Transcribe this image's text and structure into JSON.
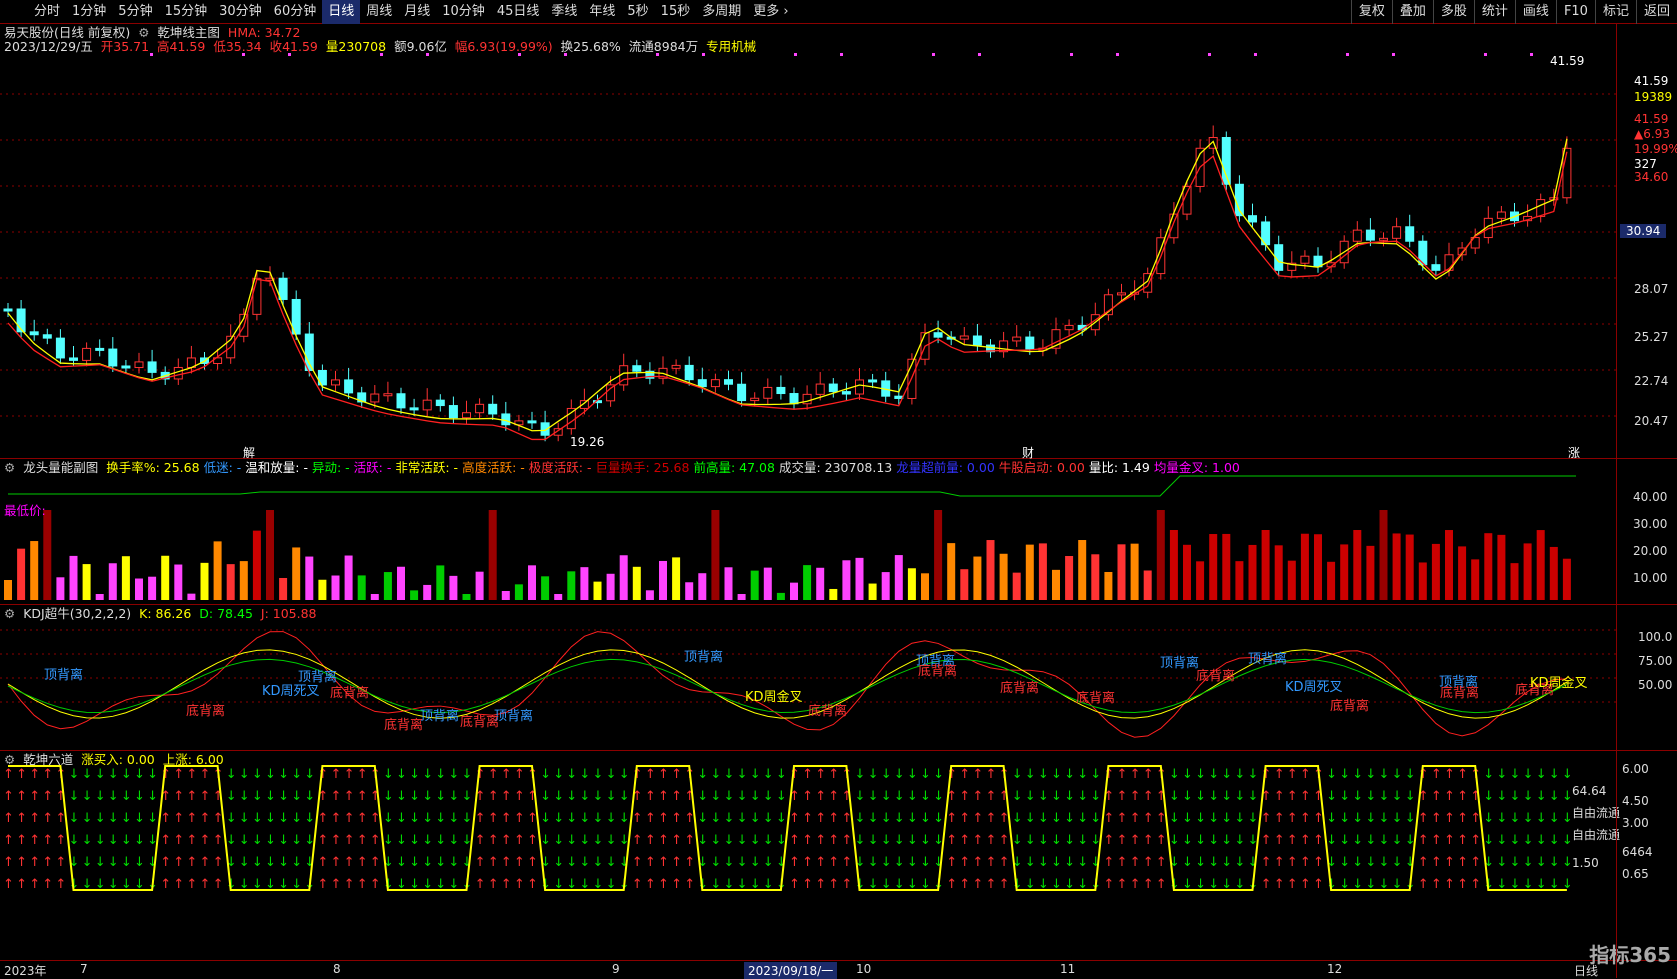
{
  "toolbar": {
    "periods": [
      "分时",
      "1分钟",
      "5分钟",
      "15分钟",
      "30分钟",
      "60分钟",
      "日线",
      "周线",
      "月线",
      "10分钟",
      "45日线",
      "季线",
      "年线",
      "5秒",
      "15秒",
      "多周期",
      "更多"
    ],
    "active": "日线",
    "right": [
      "复权",
      "叠加",
      "多股",
      "统计",
      "画线",
      "F10",
      "标记",
      "返回"
    ]
  },
  "stock": {
    "name": "易天股份(日线 前复权)",
    "indicator": "乾坤线主图",
    "hma": "HMA: 34.72",
    "date": "2023/12/29/五",
    "open": "开35.71",
    "high": "高41.59",
    "low": "低35.34",
    "close": "收41.59",
    "vol": "量230708",
    "amount": "额9.06亿",
    "range": "幅6.93(19.99%)",
    "turnover": "换25.68%",
    "float": "流通8984万",
    "tag": "专用机械"
  },
  "price_axis": {
    "labels": [
      "41.59",
      "19389",
      "41.59",
      "▲6.93",
      "19.99%",
      "327",
      "34.60",
      "30.94",
      "28.07",
      "25.27",
      "22.74",
      "20.47"
    ],
    "high_marker": "41.59",
    "low_marker": "19.26"
  },
  "markers": {
    "m1": "解",
    "m2": "财",
    "m3": "涨"
  },
  "vol_panel": {
    "title": "龙头量能副图",
    "items": [
      {
        "t": "换手率%: 25.68",
        "c": "#ffff00"
      },
      {
        "t": "低迷: -",
        "c": "#3399ff"
      },
      {
        "t": "温和放量: -",
        "c": "#ffffff"
      },
      {
        "t": "异动: -",
        "c": "#00ff00"
      },
      {
        "t": "活跃: -",
        "c": "#ff00ff"
      },
      {
        "t": "非常活跃: -",
        "c": "#ffff00"
      },
      {
        "t": "高度活跃: -",
        "c": "#ff8800"
      },
      {
        "t": "极度活跃: -",
        "c": "#ff3333"
      },
      {
        "t": "巨量换手: 25.68",
        "c": "#cc0000"
      },
      {
        "t": "前高量: 47.08",
        "c": "#00ff00"
      },
      {
        "t": "成交量: 230708.13",
        "c": "#dddddd"
      },
      {
        "t": "龙量超前量: 0.00",
        "c": "#3333ff"
      },
      {
        "t": "牛股启动: 0.00",
        "c": "#ff3333"
      },
      {
        "t": "量比: 1.49",
        "c": "#ffffff"
      },
      {
        "t": "均量金叉: 1.00",
        "c": "#ff00ff"
      }
    ],
    "sub": "最低价:",
    "axis": [
      "40.00",
      "30.00",
      "20.00",
      "10.00"
    ]
  },
  "kdj_panel": {
    "title": "KDJ超牛(30,2,2,2)",
    "k": "K: 86.26",
    "d": "D: 78.45",
    "j": "J: 105.88",
    "axis": [
      "100.0",
      "75.00",
      "50.00"
    ],
    "labels": [
      {
        "t": "顶背离",
        "c": "#3399ff"
      },
      {
        "t": "顶背离",
        "c": "#3399ff"
      },
      {
        "t": "KD周死叉",
        "c": "#3399ff"
      },
      {
        "t": "底背离",
        "c": "#ff3333"
      },
      {
        "t": "底背离",
        "c": "#ff3333"
      },
      {
        "t": "顶背离",
        "c": "#3399ff"
      },
      {
        "t": "底背离",
        "c": "#ff3333"
      },
      {
        "t": "顶背离",
        "c": "#3399ff"
      },
      {
        "t": "底背离",
        "c": "#ff3333"
      },
      {
        "t": "顶背离",
        "c": "#3399ff"
      },
      {
        "t": "KD周金叉",
        "c": "#ffff00"
      },
      {
        "t": "底背离",
        "c": "#ff3333"
      },
      {
        "t": "顶背离",
        "c": "#3399ff"
      },
      {
        "t": "底背离",
        "c": "#ff3333"
      },
      {
        "t": "底背离",
        "c": "#ff3333"
      },
      {
        "t": "底背离",
        "c": "#ff3333"
      },
      {
        "t": "顶背离",
        "c": "#3399ff"
      },
      {
        "t": "底背离",
        "c": "#ff3333"
      },
      {
        "t": "顶背离",
        "c": "#3399ff"
      },
      {
        "t": "KD周死叉",
        "c": "#3399ff"
      },
      {
        "t": "底背离",
        "c": "#ff3333"
      },
      {
        "t": "顶背离",
        "c": "#3399ff"
      },
      {
        "t": "底背离",
        "c": "#ff3333"
      },
      {
        "t": "底背离",
        "c": "#ff3333"
      },
      {
        "t": "KD周金叉",
        "c": "#ffff00"
      }
    ]
  },
  "six_panel": {
    "title": "乾坤六道",
    "buy": "涨买入: 0.00",
    "up": "上涨: 6.00",
    "axis": [
      "6.00",
      "64.64",
      "4.50",
      "自由流通",
      "3.00",
      "自由流通",
      "6464",
      "1.50",
      "0.65"
    ]
  },
  "x_axis": {
    "labels": [
      "2023年",
      "7",
      "8",
      "9",
      "2023/09/18/一",
      "10",
      "11",
      "12"
    ],
    "period": "日线"
  },
  "logo": "指标365",
  "colors": {
    "up": "#ff3333",
    "down": "#54ffff",
    "ma_yellow": "#ffff00",
    "ma_red": "#ff2020"
  }
}
